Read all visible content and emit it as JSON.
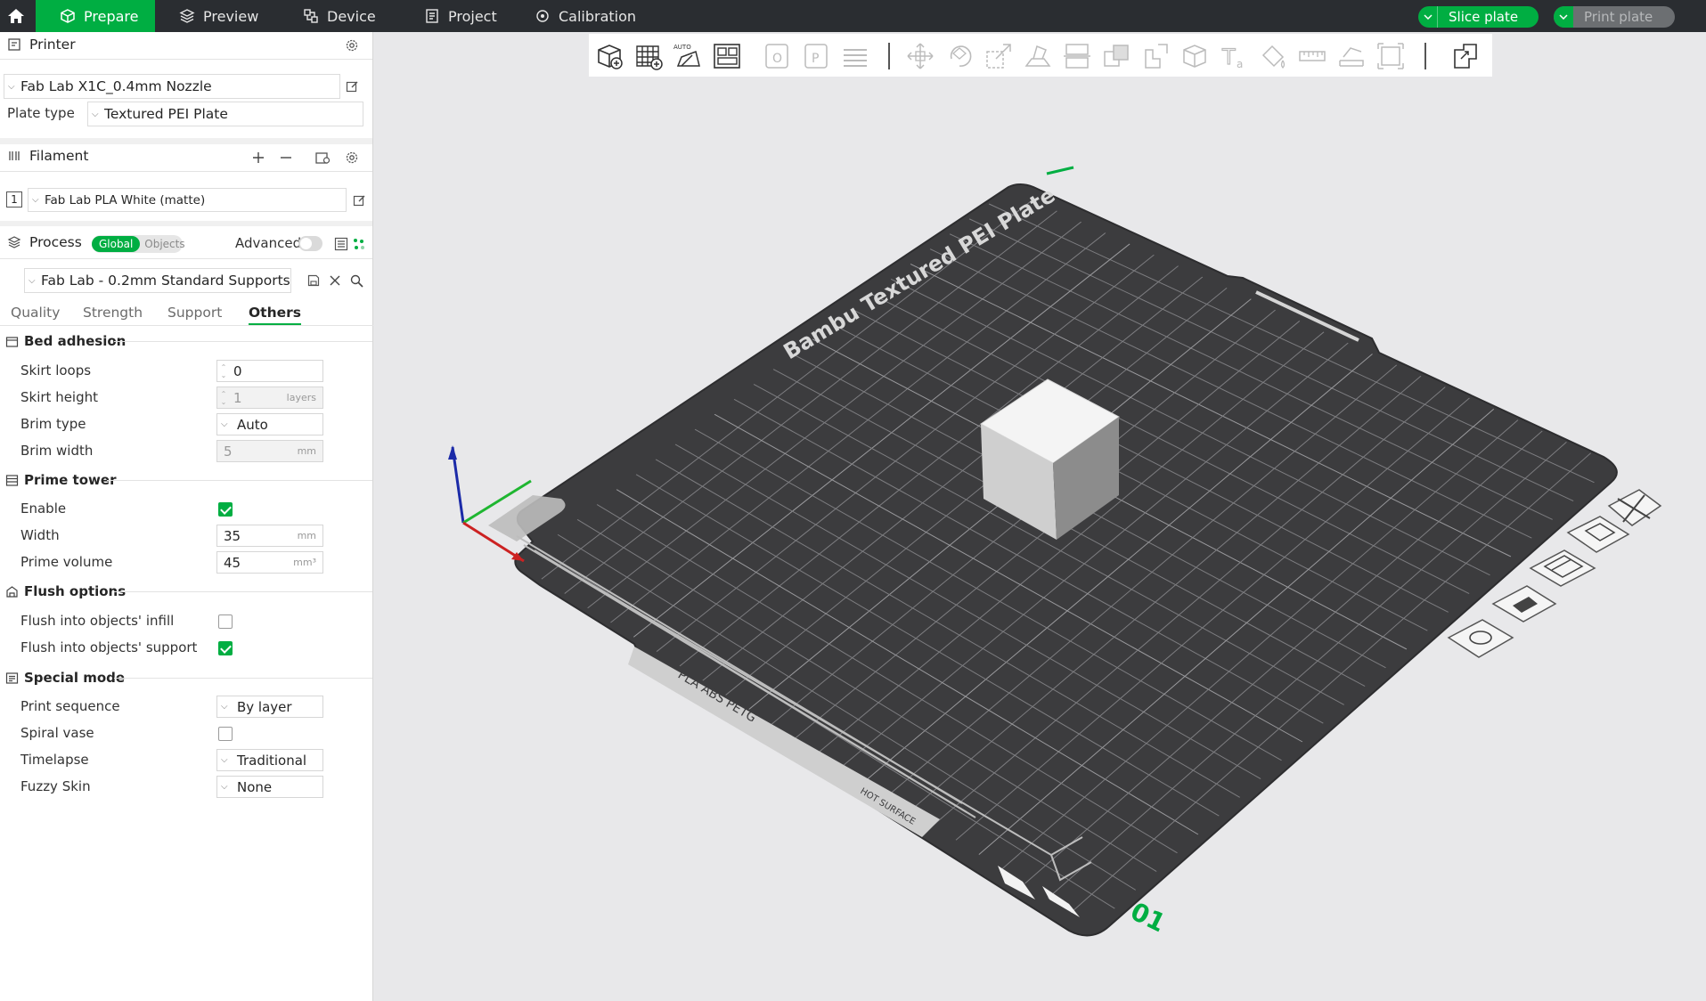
{
  "topbar": {
    "tabs": [
      {
        "label": "Prepare",
        "icon": "cube-icon",
        "active": true
      },
      {
        "label": "Preview",
        "icon": "layers-icon"
      },
      {
        "label": "Device",
        "icon": "device-icon"
      },
      {
        "label": "Project",
        "icon": "document-icon"
      },
      {
        "label": "Calibration",
        "icon": "calibration-icon"
      }
    ],
    "slice_label": "Slice plate",
    "print_label": "Print plate"
  },
  "printer": {
    "title": "Printer",
    "name": "Fab Lab X1C_0.4mm Nozzle",
    "plate_type_label": "Plate type",
    "plate_type": "Textured PEI Plate"
  },
  "filament": {
    "title": "Filament",
    "slot": "1",
    "name": "Fab Lab PLA White (matte)"
  },
  "process": {
    "title": "Process",
    "global_label": "Global",
    "objects_label": "Objects",
    "advanced_label": "Advanced",
    "advanced_on": false,
    "profile": "Fab Lab - 0.2mm Standard Supports",
    "tabs": [
      "Quality",
      "Strength",
      "Support",
      "Others"
    ],
    "active_tab": "Others"
  },
  "groups": {
    "bed_adhesion": {
      "title": "Bed adhesion",
      "skirt_loops": {
        "label": "Skirt loops",
        "value": "0"
      },
      "skirt_height": {
        "label": "Skirt height",
        "value": "1",
        "unit": "layers"
      },
      "brim_type": {
        "label": "Brim type",
        "value": "Auto"
      },
      "brim_width": {
        "label": "Brim width",
        "value": "5",
        "unit": "mm"
      }
    },
    "prime_tower": {
      "title": "Prime tower",
      "enable": {
        "label": "Enable",
        "checked": true
      },
      "width": {
        "label": "Width",
        "value": "35",
        "unit": "mm"
      },
      "prime_volume": {
        "label": "Prime volume",
        "value": "45",
        "unit": "mm³"
      }
    },
    "flush_options": {
      "title": "Flush options",
      "infill": {
        "label": "Flush into objects' infill",
        "checked": false
      },
      "support": {
        "label": "Flush into objects' support",
        "checked": true
      }
    },
    "special_mode": {
      "title": "Special mode",
      "print_sequence": {
        "label": "Print sequence",
        "value": "By layer"
      },
      "spiral_vase": {
        "label": "Spiral vase",
        "checked": false
      },
      "timelapse": {
        "label": "Timelapse",
        "value": "Traditional"
      },
      "fuzzy_skin": {
        "label": "Fuzzy Skin",
        "value": "None"
      }
    }
  },
  "plate": {
    "brand_text": "Bambu Textured PEI Plate",
    "materials_text": "PLA ABS PETG",
    "hot_surface_text": "HOT SURFACE",
    "plate_number": "01",
    "accent": "#00ae42"
  },
  "colors": {
    "accent": "#00ae42",
    "topbar": "#2a2d31",
    "plate": "#3d3d3f",
    "background": "#e8e8ea"
  }
}
